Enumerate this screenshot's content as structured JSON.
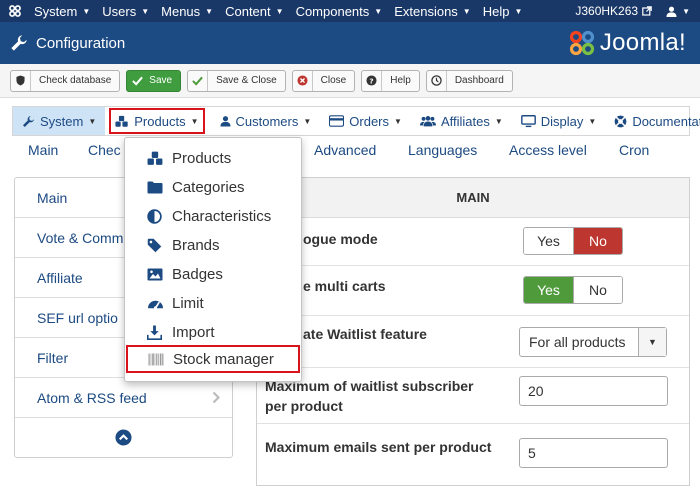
{
  "topnav": {
    "items": [
      {
        "label": "System"
      },
      {
        "label": "Users"
      },
      {
        "label": "Menus"
      },
      {
        "label": "Content"
      },
      {
        "label": "Components"
      },
      {
        "label": "Extensions"
      },
      {
        "label": "Help"
      }
    ],
    "site_name": "J360HK263"
  },
  "header": {
    "title": "Configuration",
    "brand": "Joomla!"
  },
  "toolbar": {
    "check_database": "Check database",
    "save": "Save",
    "save_close": "Save & Close",
    "close": "Close",
    "help": "Help",
    "dashboard": "Dashboard"
  },
  "tabs": {
    "system": "System",
    "products": "Products",
    "customers": "Customers",
    "orders": "Orders",
    "affiliates": "Affiliates",
    "display": "Display",
    "documentation": "Documentation"
  },
  "subtabs": {
    "main": "Main",
    "check": "Chec",
    "advanced": "Advanced",
    "languages": "Languages",
    "access_level": "Access level",
    "cron": "Cron"
  },
  "sidebar": {
    "items": [
      {
        "label": "Main"
      },
      {
        "label": "Vote & Comm"
      },
      {
        "label": "Affiliate"
      },
      {
        "label": "SEF url optio"
      },
      {
        "label": "Filter"
      },
      {
        "label": "Atom & RSS feed"
      }
    ]
  },
  "panel": {
    "heading": "MAIN",
    "rows": {
      "catalogue_mode": {
        "label": "ogue mode",
        "yes": "Yes",
        "no": "No"
      },
      "multi_carts": {
        "label": "e multi carts",
        "yes": "Yes",
        "no": "No"
      },
      "waitlist": {
        "label": "ate Waitlist feature",
        "value": "For all products"
      },
      "max_subscriber": {
        "label_line1": "Maximum of waitlist subscriber",
        "label_line2": "per product",
        "value": "20"
      },
      "max_emails": {
        "label": "Maximum emails sent per product",
        "value": "5"
      }
    }
  },
  "dropdown": {
    "items": [
      {
        "label": "Products",
        "icon": "cubes-icon"
      },
      {
        "label": "Categories",
        "icon": "folder-icon"
      },
      {
        "label": "Characteristics",
        "icon": "contrast-icon"
      },
      {
        "label": "Brands",
        "icon": "tag-icon"
      },
      {
        "label": "Badges",
        "icon": "image-icon"
      },
      {
        "label": "Limit",
        "icon": "dashboard-icon"
      },
      {
        "label": "Import",
        "icon": "download-icon"
      },
      {
        "label": "Stock manager",
        "icon": "barcode-icon"
      }
    ]
  },
  "colors": {
    "topnav_bg": "#1a3867",
    "header_bg": "#1c4a82",
    "link": "#1c4a82",
    "save_green": "#3f9d40",
    "highlight_red": "#d9131b",
    "no_red": "#bd362f",
    "yes_green": "#4f9b3c"
  }
}
